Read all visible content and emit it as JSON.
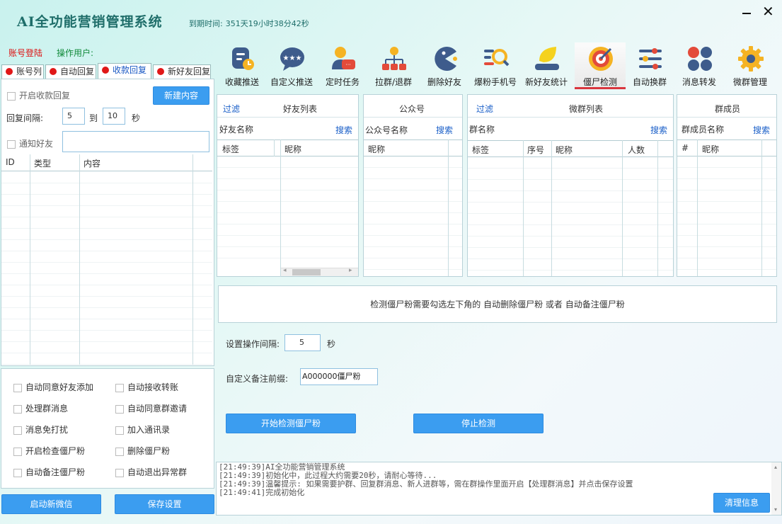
{
  "app": {
    "title": "AI全功能营销管理系统",
    "expire_label": "到期时间:",
    "expire_value": "351天19小时38分42秒",
    "account_login": "账号登陆",
    "operator_label": "操作用户:"
  },
  "toolbar": [
    {
      "label": "收藏推送",
      "icon": "bookmark-push-icon"
    },
    {
      "label": "自定义推送",
      "icon": "chat-bubble-icon"
    },
    {
      "label": "定时任务",
      "icon": "scheduled-task-icon"
    },
    {
      "label": "拉群/退群",
      "icon": "group-tree-icon"
    },
    {
      "label": "删除好友",
      "icon": "pacman-icon"
    },
    {
      "label": "爆粉手机号",
      "icon": "search-list-icon"
    },
    {
      "label": "新好友统计",
      "icon": "leaf-stats-icon"
    },
    {
      "label": "僵尸检测",
      "icon": "target-icon"
    },
    {
      "label": "自动换群",
      "icon": "sliders-icon"
    },
    {
      "label": "消息转发",
      "icon": "dots-grid-icon"
    },
    {
      "label": "微群管理",
      "icon": "gear-icon"
    }
  ],
  "tabs": [
    "账号列",
    "自动回复",
    "收款回复",
    "新好友回复"
  ],
  "left": {
    "enable_payment_reply": "开启收款回复",
    "new_content": "新建内容",
    "reply_interval_label": "回复间隔:",
    "interval_from": "5",
    "to": "到",
    "interval_to": "10",
    "seconds": "秒",
    "notify_friend": "通知好友",
    "grid_headers": [
      "ID",
      "类型",
      "内容"
    ],
    "options": [
      "自动同意好友添加",
      "自动接收转账",
      "处理群消息",
      "自动同意群邀请",
      "消息免打扰",
      "加入通讯录",
      "开启检查僵尸粉",
      "删除僵尸粉",
      "自动备注僵尸粉",
      "自动退出异常群"
    ],
    "start_wechat": "启动新微信",
    "save_settings": "保存设置"
  },
  "friends": {
    "filter": "过滤",
    "title": "好友列表",
    "name_label": "好友名称",
    "search": "搜索",
    "cols": [
      "标签",
      "昵称"
    ]
  },
  "official": {
    "title": "公众号",
    "name_label": "公众号名称",
    "search": "搜索",
    "cols": [
      "昵称"
    ]
  },
  "groups": {
    "filter": "过滤",
    "title": "微群列表",
    "name_label": "群名称",
    "search": "搜索",
    "cols": [
      "标签",
      "序号",
      "昵称",
      "人数"
    ]
  },
  "members": {
    "title": "群成员",
    "name_label": "群成员名称",
    "search": "搜索",
    "cols": [
      "#",
      "昵称"
    ]
  },
  "zombie": {
    "hint": "检测僵尸粉需要勾选左下角的 自动删除僵尸粉 或者 自动备注僵尸粉",
    "interval_label": "设置操作间隔:",
    "interval_value": "5",
    "seconds": "秒",
    "prefix_label": "自定义备注前缀:",
    "prefix_value": "A000000僵尸粉",
    "start": "开始检测僵尸粉",
    "stop": "停止检测"
  },
  "log": {
    "lines": [
      "[21:49:39]AI全功能营销管理系统",
      "[21:49:39]初始化中，此过程大约需要20秒，请耐心等待...",
      "[21:49:39]温馨提示: 如果需要护群、回复群消息、新人进群等，需在群操作里面开启【处理群消息】并点击保存设置",
      "[21:49:41]完成初始化"
    ],
    "clear": "清理信息"
  }
}
